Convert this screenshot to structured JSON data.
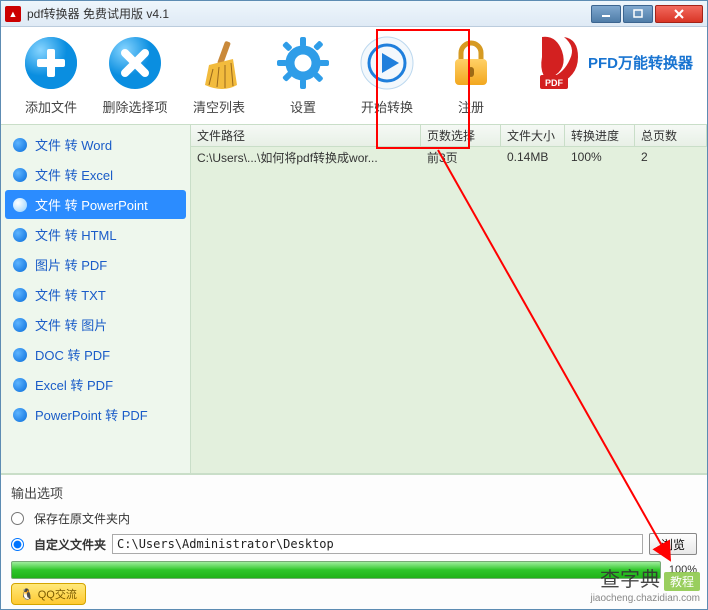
{
  "window": {
    "title": "pdf转换器 免费试用版 v4.1"
  },
  "toolbar": {
    "add_label": "添加文件",
    "remove_label": "删除选择项",
    "clear_label": "清空列表",
    "settings_label": "设置",
    "start_label": "开始转换",
    "register_label": "注册",
    "logo_text": "PFD万能转换器"
  },
  "sidebar": {
    "items": [
      {
        "label": "文件 转 Word"
      },
      {
        "label": "文件 转 Excel"
      },
      {
        "label": "文件 转 PowerPoint"
      },
      {
        "label": "文件 转 HTML"
      },
      {
        "label": "图片 转 PDF"
      },
      {
        "label": "文件 转 TXT"
      },
      {
        "label": "文件 转 图片"
      },
      {
        "label": "DOC 转 PDF"
      },
      {
        "label": "Excel 转 PDF"
      },
      {
        "label": "PowerPoint 转 PDF"
      }
    ],
    "active_index": 2
  },
  "table": {
    "headers": {
      "path": "文件路径",
      "pages": "页数选择",
      "size": "文件大小",
      "progress": "转换进度",
      "total": "总页数"
    },
    "rows": [
      {
        "path": "C:\\Users\\...\\如何将pdf转换成wor...",
        "pages": "前3页",
        "size": "0.14MB",
        "progress": "100%",
        "total": "2"
      }
    ]
  },
  "output": {
    "section_title": "输出选项",
    "opt_keep": "保存在原文件夹内",
    "opt_custom": "自定义文件夹",
    "custom_path": "C:\\Users\\Administrator\\Desktop",
    "browse": "浏览",
    "progress_value": "100%"
  },
  "footer": {
    "qq": "QQ交流"
  },
  "watermark": {
    "big": "查字典",
    "tag": "教程",
    "url": "jiaocheng.chazidian.com"
  }
}
